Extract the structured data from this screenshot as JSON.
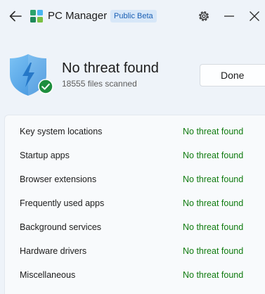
{
  "titlebar": {
    "back_icon": "back-arrow-icon",
    "logo_icon": "pc-manager-logo-icon",
    "app_title": "PC Manager",
    "badge": "Public Beta",
    "settings_icon": "gear-icon",
    "minimize_icon": "minimize-icon",
    "close_icon": "close-icon"
  },
  "hero": {
    "shield_icon": "shield-lightning-icon",
    "check_icon": "check-circle-icon",
    "title": "No threat found",
    "subtitle": "18555 files scanned",
    "done_label": "Done"
  },
  "results": [
    {
      "label": "Key system locations",
      "status": "No threat found"
    },
    {
      "label": "Startup apps",
      "status": "No threat found"
    },
    {
      "label": "Browser extensions",
      "status": "No threat found"
    },
    {
      "label": "Frequently used apps",
      "status": "No threat found"
    },
    {
      "label": "Background services",
      "status": "No threat found"
    },
    {
      "label": "Hardware drivers",
      "status": "No threat found"
    },
    {
      "label": "Miscellaneous",
      "status": "No threat found"
    }
  ],
  "colors": {
    "background": "#eef3f9",
    "status_green": "#0f7b0f",
    "badge_bg": "#d7e7f8",
    "badge_text": "#1a5fb4",
    "shield_blue": "#4aa3e8"
  }
}
